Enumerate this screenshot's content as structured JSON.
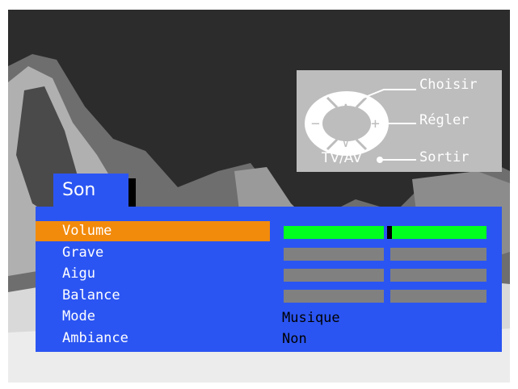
{
  "help": {
    "choose_label": "Choisir",
    "adjust_label": "Régler",
    "exit_label": "Sortir",
    "tvav_label": "TV/AV",
    "up_symbol": "∧",
    "down_symbol": "∨",
    "minus_symbol": "−",
    "plus_symbol": "+"
  },
  "menu": {
    "title": "Son",
    "items": [
      {
        "label": "Volume",
        "selected": true,
        "level": 0.52
      },
      {
        "label": "Grave"
      },
      {
        "label": "Aigu"
      },
      {
        "label": "Balance"
      },
      {
        "label": "Mode",
        "value": "Musique"
      },
      {
        "label": "Ambiance",
        "value": "Non"
      }
    ]
  },
  "colors": {
    "panel": "#2b55f2",
    "selection": "#f28a0c",
    "volume_bar": "#00ff1e",
    "slider_inactive": "#808080"
  }
}
